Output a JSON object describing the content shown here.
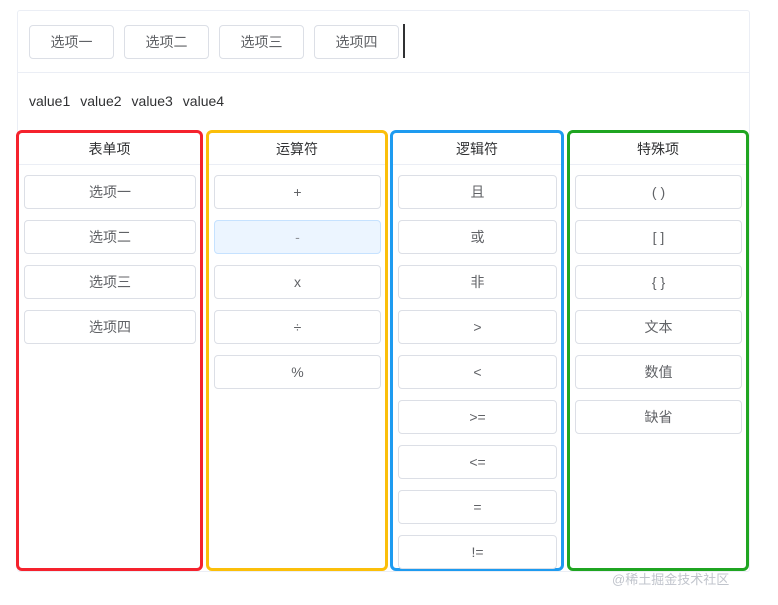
{
  "tokens": [
    "选项一",
    "选项二",
    "选项三",
    "选项四"
  ],
  "values": [
    "value1",
    "value2",
    "value3",
    "value4"
  ],
  "columns": {
    "form": {
      "title": "表单项",
      "items": [
        "选项一",
        "选项二",
        "选项三",
        "选项四"
      ]
    },
    "operators": {
      "title": "运算符",
      "items": [
        "+",
        "-",
        "x",
        "÷",
        "%"
      ],
      "active_index": 1
    },
    "logic": {
      "title": "逻辑符",
      "items": [
        "且",
        "或",
        "非",
        ">",
        "<",
        ">=",
        "<=",
        "=",
        "!="
      ]
    },
    "special": {
      "title": "特殊项",
      "items": [
        "( )",
        "[ ]",
        "{ }",
        "文本",
        "数值",
        "缺省"
      ]
    }
  },
  "colors": {
    "form_border": "#f5222d",
    "operators_border": "#fbbf0a",
    "logic_border": "#1e9bf0",
    "special_border": "#1fa521"
  },
  "watermark": "@稀土掘金技术社区"
}
